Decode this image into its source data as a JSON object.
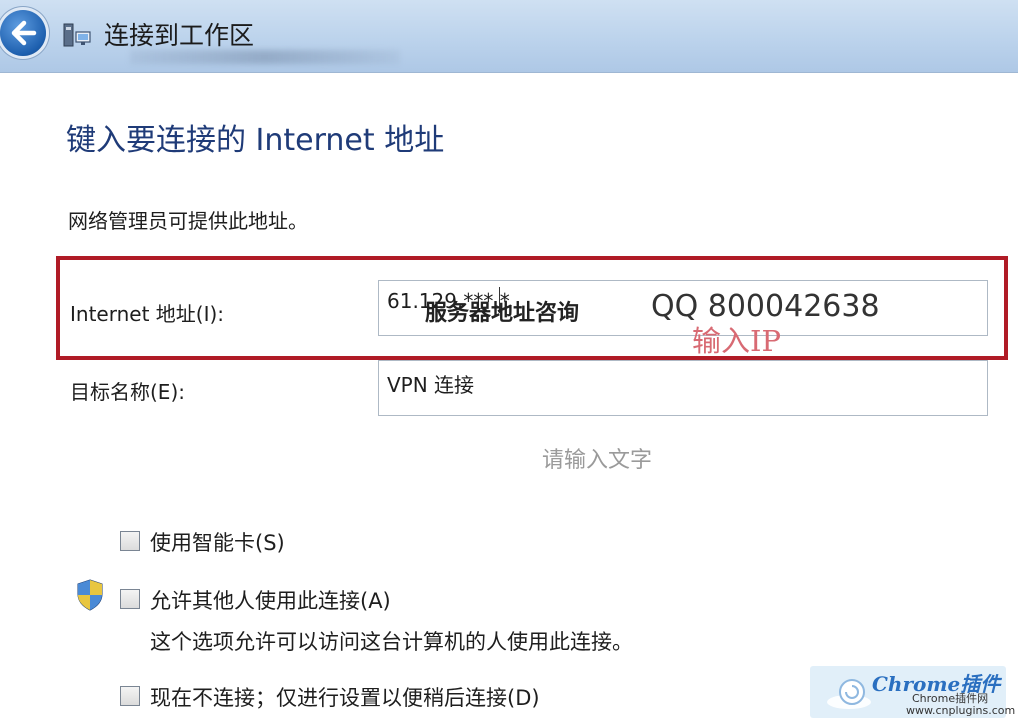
{
  "window": {
    "title": "连接到工作区"
  },
  "page": {
    "heading": "键入要连接的 Internet 地址",
    "description": "网络管理员可提供此地址。"
  },
  "form": {
    "internet_address": {
      "label": "Internet 地址(I):",
      "value": "61.129.***.*",
      "overlay_text": "服务器地址咨询",
      "qq_text": "QQ 800042638"
    },
    "destination_name": {
      "label": "目标名称(E):",
      "value": "VPN 连接"
    }
  },
  "annotations": {
    "red_note": "输入IP",
    "placeholder_watermark": "请输入文字",
    "highlight_color": "#b01b26"
  },
  "options": [
    {
      "label": "使用智能卡(S)",
      "checked": false
    },
    {
      "label": "允许其他人使用此连接(A)",
      "checked": false,
      "icon": "uac-shield-icon",
      "description": "这个选项允许可以访问这台计算机的人使用此连接。"
    },
    {
      "label": "现在不连接；仅进行设置以便稍后连接(D)",
      "checked": false
    }
  ],
  "watermark": {
    "brand": "Chrome插件",
    "line1": "Chrome插件网",
    "line2": "www.cnplugins.com"
  }
}
